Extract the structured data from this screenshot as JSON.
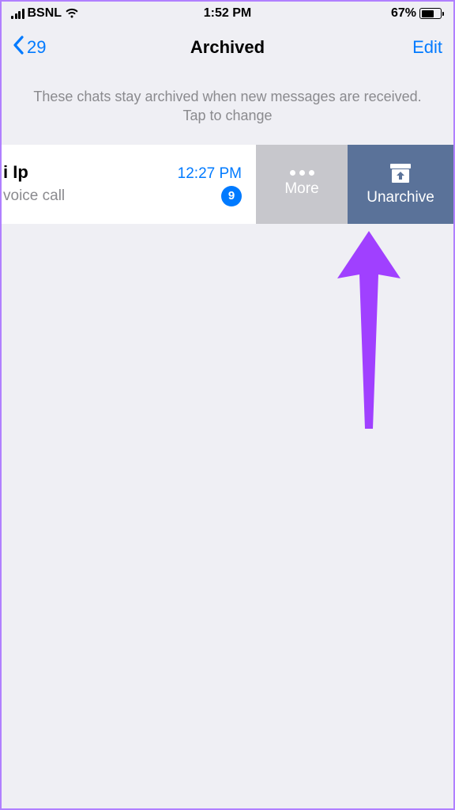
{
  "status": {
    "carrier": "BSNL",
    "time": "1:52 PM",
    "battery_percent": "67%",
    "battery_fill_width": "67%"
  },
  "nav": {
    "back_count": "29",
    "title": "Archived",
    "edit": "Edit"
  },
  "info_text": "These chats stay archived when new messages are received. Tap to change",
  "chat": {
    "name": "i Ip",
    "subtitle": "voice call",
    "time": "12:27 PM",
    "unread": "9"
  },
  "swipe": {
    "more": "More",
    "unarchive": "Unarchive"
  },
  "colors": {
    "ios_blue": "#007aff",
    "unarchive_bg": "#5a7299",
    "more_bg": "#c7c7cc",
    "arrow": "#a040ff"
  }
}
